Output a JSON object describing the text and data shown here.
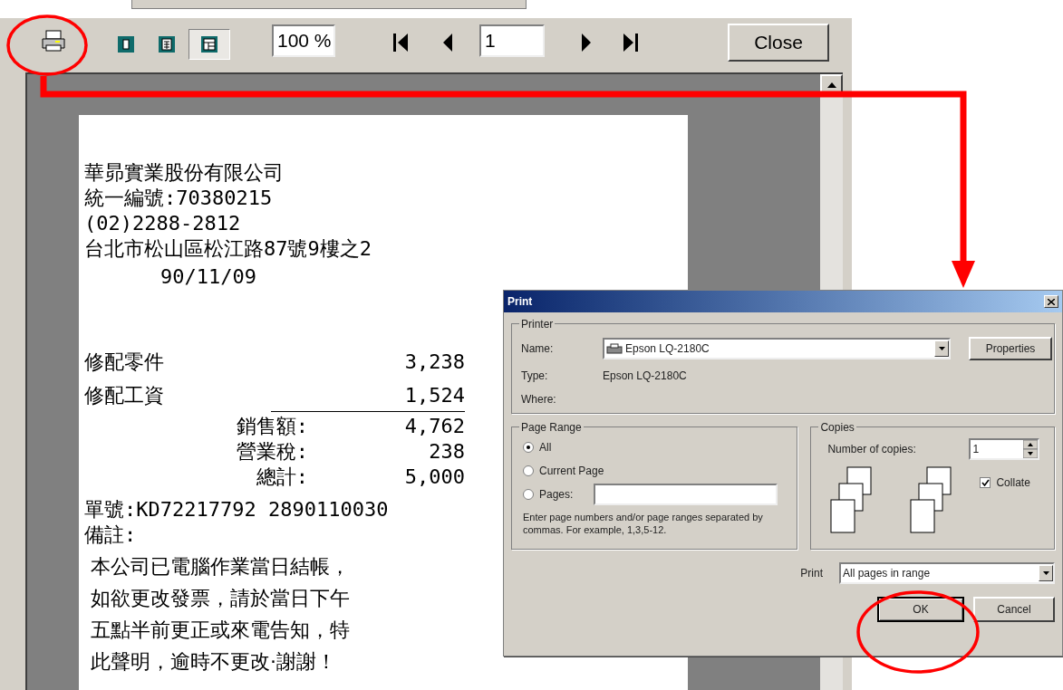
{
  "preview_window": {
    "toolbar": {
      "zoom": "100 %",
      "page": "1",
      "close": "Close",
      "view_modes": [
        {
          "selected": false
        },
        {
          "selected": false
        },
        {
          "selected": true
        }
      ]
    },
    "receipt": {
      "header_lines": [
        "華昴實業股份有限公司",
        "統一編號:70380215",
        "(02)2288-2812",
        "台北市松山區松江路87號9樓之2"
      ],
      "date": "90/11/09",
      "items": [
        {
          "label": "修配零件",
          "amount": "3,238"
        },
        {
          "label": "修配工資",
          "amount": "1,524"
        }
      ],
      "totals": [
        {
          "label": "銷售額:",
          "amount": "4,762"
        },
        {
          "label": "營業稅:",
          "amount": "238"
        },
        {
          "label": "總計:",
          "amount": "5,000"
        }
      ],
      "order_no": "單號:KD72217792 2890110030",
      "remarks_label": "備註:",
      "notice_lines": [
        "本公司已電腦作業當日結帳，",
        "如欲更改發票，請於當日下午",
        "五點半前更正或來電告知，特",
        "此聲明，逾時不更改·謝謝！"
      ]
    }
  },
  "print_dialog": {
    "title": "Print",
    "printer": {
      "legend": "Printer",
      "name_label": "Name:",
      "name_value": "Epson LQ-2180C",
      "properties": "Properties",
      "type_label": "Type:",
      "type_value": "Epson LQ-2180C",
      "where_label": "Where:"
    },
    "page_range": {
      "legend": "Page Range",
      "options": [
        {
          "label": "All",
          "selected": true
        },
        {
          "label": "Current Page",
          "selected": false
        },
        {
          "label": "Pages:",
          "selected": false
        }
      ],
      "hint": "Enter page numbers and/or page ranges separated by commas.  For example, 1,3,5-12."
    },
    "copies": {
      "legend": "Copies",
      "label": "Number of copies:",
      "value": "1",
      "collate": {
        "label": "Collate",
        "checked": true
      }
    },
    "print_label": "Print",
    "print_value": "All pages in range",
    "ok": "OK",
    "cancel": "Cancel"
  }
}
